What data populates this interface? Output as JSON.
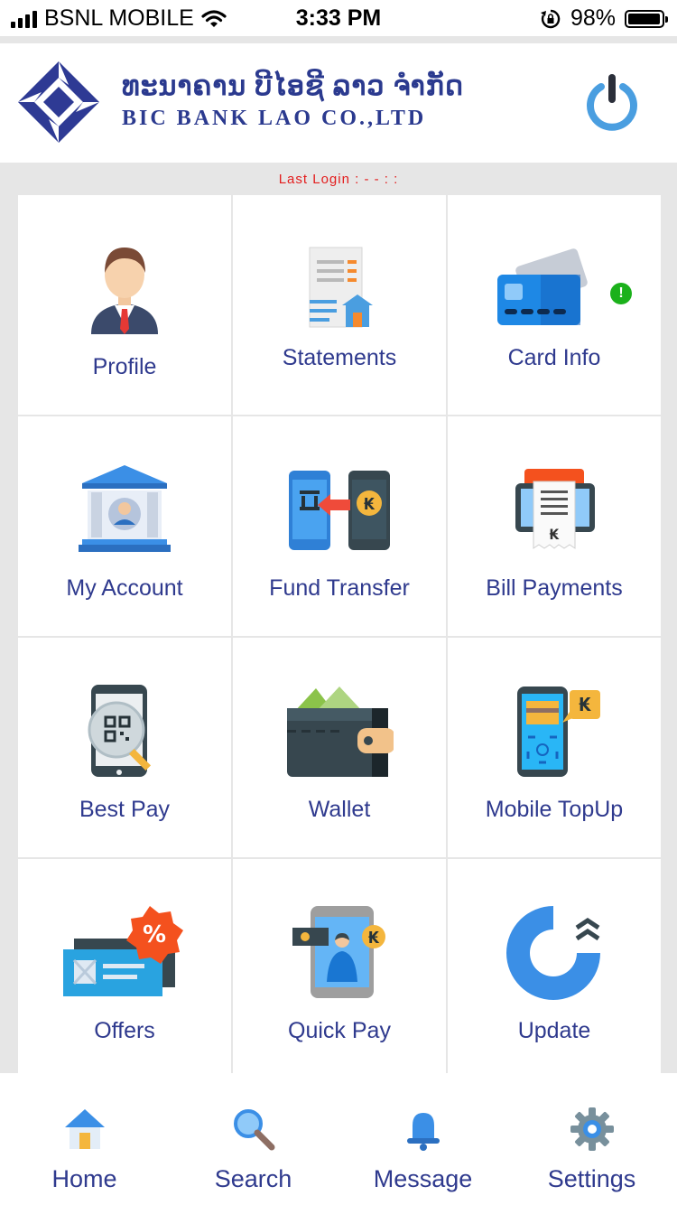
{
  "status_bar": {
    "carrier": "BSNL MOBILE",
    "time": "3:33 PM",
    "battery_text": "98%",
    "battery_level": 0.98
  },
  "header": {
    "bank_name_lao": "ທະນາຄານ ບີໄອຊີ ລາວ ຈຳກັດ",
    "bank_name_en": "BIC BANK LAO CO.,LTD",
    "logo_icon": "bic-diamond-logo",
    "power_icon": "power-icon",
    "brand_color": "#2b3a8f"
  },
  "last_login": "Last Login : - -    : :",
  "menu": [
    {
      "label": "Profile",
      "icon": "profile-icon"
    },
    {
      "label": "Statements",
      "icon": "statement-icon"
    },
    {
      "label": "Card Info",
      "icon": "card-icon",
      "badge": "!"
    },
    {
      "label": "My Account",
      "icon": "bank-account-icon"
    },
    {
      "label": "Fund Transfer",
      "icon": "fund-transfer-icon"
    },
    {
      "label": "Bill Payments",
      "icon": "bill-payment-icon"
    },
    {
      "label": "Best Pay",
      "icon": "qr-scan-icon"
    },
    {
      "label": "Wallet",
      "icon": "wallet-icon"
    },
    {
      "label": "Mobile TopUp",
      "icon": "mobile-topup-icon"
    },
    {
      "label": "Offers",
      "icon": "offers-icon"
    },
    {
      "label": "Quick Pay",
      "icon": "quick-pay-icon"
    },
    {
      "label": "Update",
      "icon": "update-icon"
    }
  ],
  "tabs": [
    {
      "label": "Home",
      "icon": "home-icon"
    },
    {
      "label": "Search",
      "icon": "search-icon"
    },
    {
      "label": "Message",
      "icon": "bell-icon"
    },
    {
      "label": "Settings",
      "icon": "gear-icon"
    }
  ]
}
